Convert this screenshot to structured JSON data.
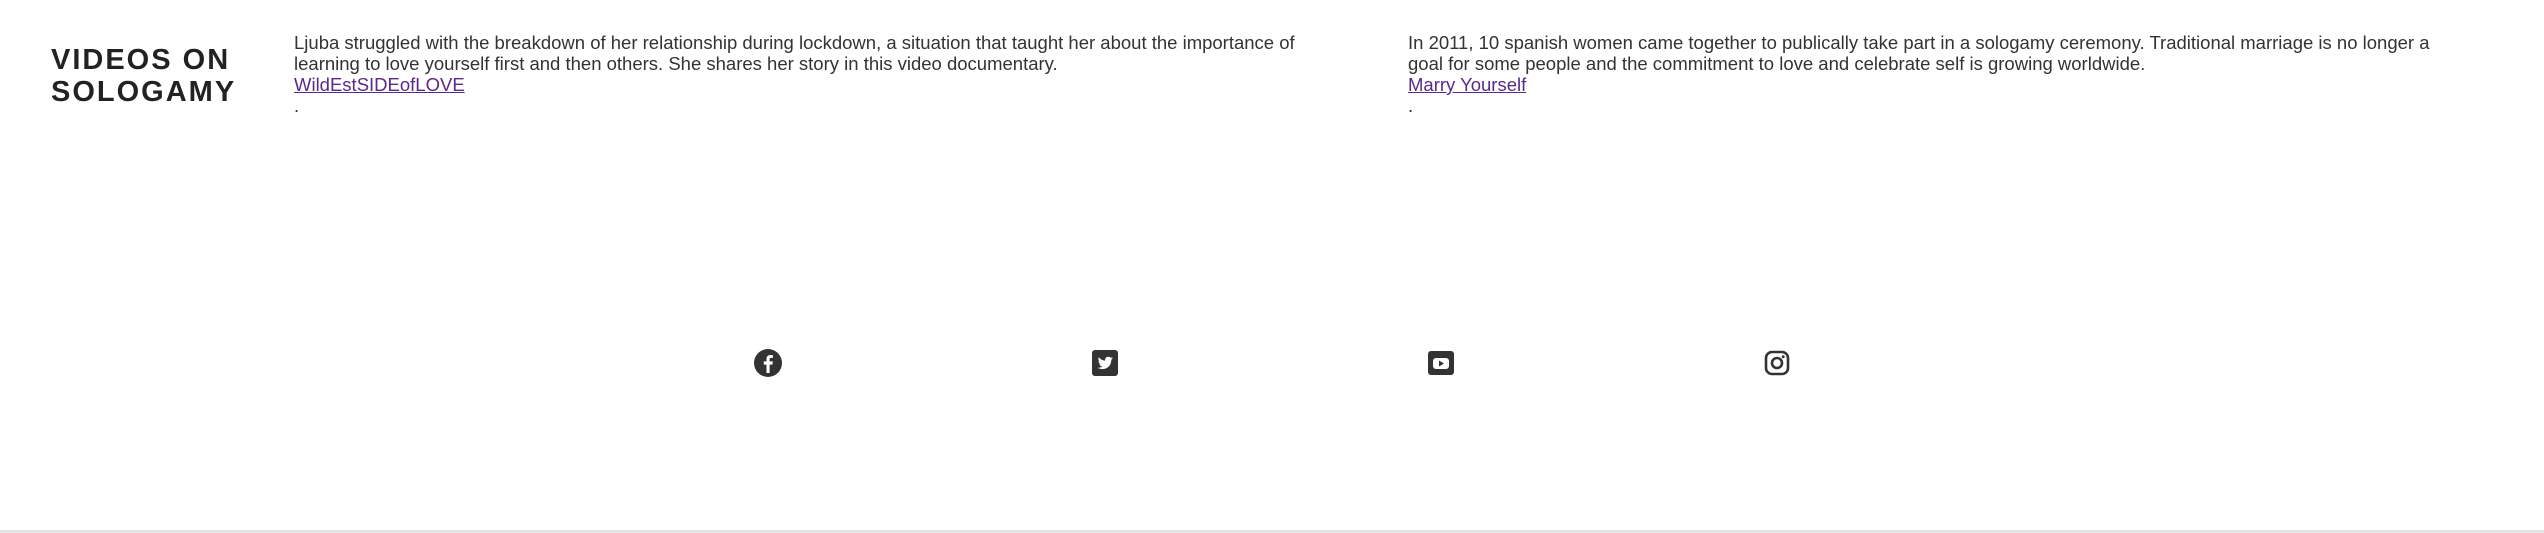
{
  "section": {
    "title_line1": "VIDEOS ON",
    "title_line2": "SOLOGAMY"
  },
  "videos": [
    {
      "description": "Ljuba struggled with the breakdown of her relationship during lockdown, a situation that taught her about the importance of learning to love yourself first and then others. She shares her story in this video documentary.",
      "link_text": "WildEstSIDEofLOVE",
      "trailing": "."
    },
    {
      "description": "In 2011, 10 spanish women came together to publically take part in a sologamy ceremony. Traditional marriage is no longer a goal for some people and the commitment to love and celebrate self is growing worldwide.",
      "link_text": "Marry Yourself",
      "trailing": "."
    }
  ],
  "social": {
    "icons": [
      "facebook-icon",
      "twitter-icon",
      "youtube-icon",
      "instagram-icon"
    ],
    "icon_color": "#333333"
  },
  "colors": {
    "link": "#5b2a86",
    "text": "#333333",
    "heading": "#222222",
    "background": "#ffffff"
  }
}
